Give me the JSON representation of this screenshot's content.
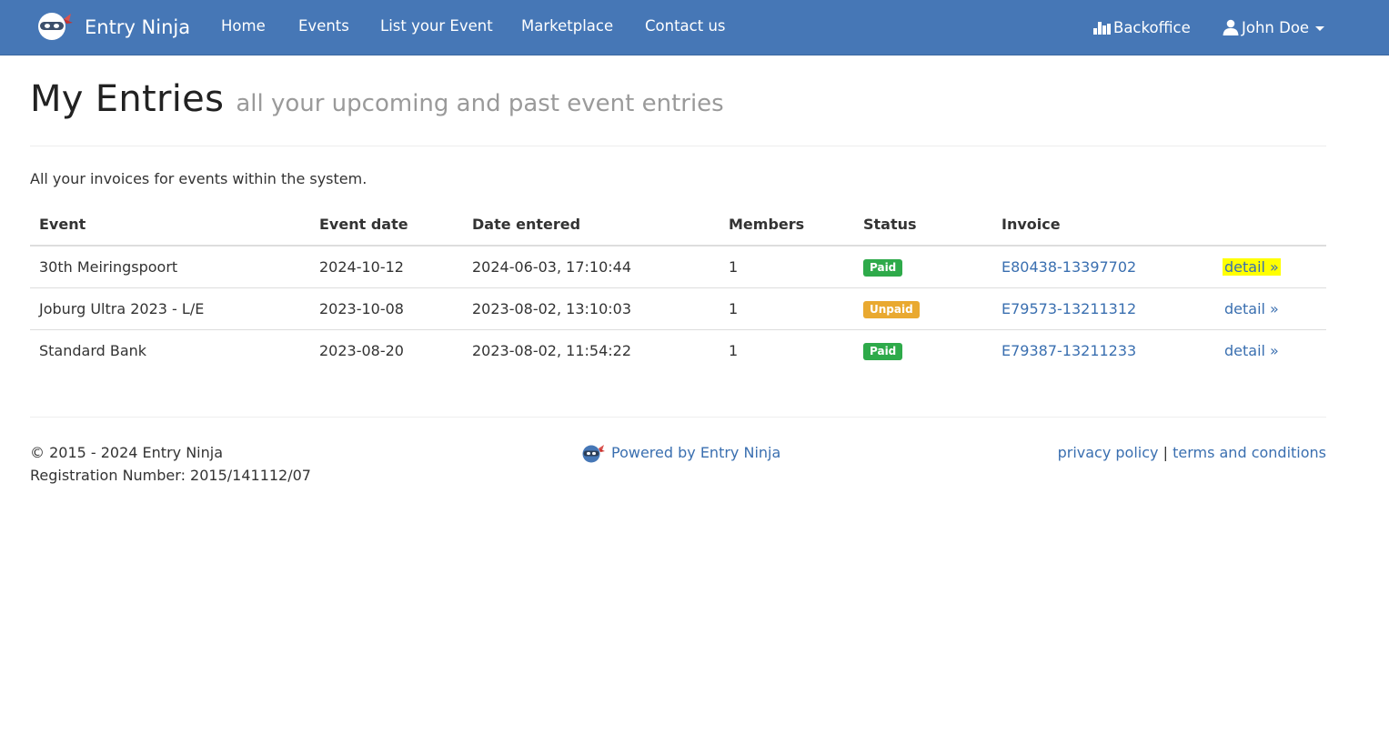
{
  "colors": {
    "navbar": "#4677b6",
    "link": "#3a6fb0",
    "paid": "#2eaa4a",
    "unpaid": "#e9a930",
    "highlight": "#ffff00"
  },
  "navbar": {
    "brand_icon": "ninja-logo-icon",
    "brand": "Entry Ninja",
    "links": [
      "Home",
      "Events",
      "List your Event",
      "Marketplace",
      "Contact us"
    ],
    "backoffice_icon": "bar-chart-icon",
    "backoffice": "Backoffice",
    "user_icon": "user-icon",
    "user": "John Doe"
  },
  "page": {
    "title": "My Entries",
    "subtitle": "all your upcoming and past event entries",
    "intro": "All your invoices for events within the system."
  },
  "table": {
    "headers": [
      "Event",
      "Event date",
      "Date entered",
      "Members",
      "Status",
      "Invoice",
      ""
    ],
    "rows": [
      {
        "event": "30th Meiringspoort",
        "event_date": "2024-10-12",
        "date_entered": "2024-06-03, 17:10:44",
        "members": "1",
        "status": "Paid",
        "invoice": "E80438-13397702",
        "detail": "detail »",
        "highlighted": true
      },
      {
        "event": "Joburg Ultra 2023 - L/E",
        "event_date": "2023-10-08",
        "date_entered": "2023-08-02, 13:10:03",
        "members": "1",
        "status": "Unpaid",
        "invoice": "E79573-13211312",
        "detail": "detail »",
        "highlighted": false
      },
      {
        "event": "Standard Bank",
        "event_date": "2023-08-20",
        "date_entered": "2023-08-02, 11:54:22",
        "members": "1",
        "status": "Paid",
        "invoice": "E79387-13211233",
        "detail": "detail »",
        "highlighted": false
      }
    ]
  },
  "footer": {
    "copyright": "© 2015 - 2024 Entry Ninja",
    "registration": "Registration Number: 2015/141112/07",
    "powered_by": "Powered by Entry Ninja",
    "privacy": "privacy policy",
    "separator": "|",
    "terms": "terms and conditions"
  }
}
